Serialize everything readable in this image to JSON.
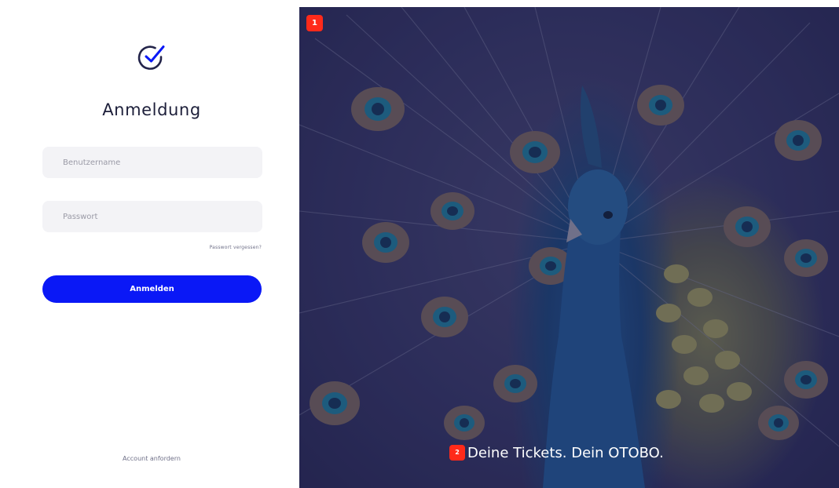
{
  "login": {
    "logo_icon": "check-circle-icon",
    "title": "Anmeldung",
    "username_placeholder": "Benutzername",
    "password_placeholder": "Passwort",
    "forgot_password": "Passwort vergessen?",
    "submit_label": "Anmelden",
    "request_account": "Account anfordern"
  },
  "hero": {
    "image": "peacock-photo",
    "marker_1": "1",
    "marker_2": "2",
    "tagline": "Deine Tickets. Dein OTOBO."
  },
  "colors": {
    "accent": "#0a18f6",
    "input_bg": "#f3f3f6",
    "marker": "#ff2a1a",
    "hero_tint": "#2e2f58"
  }
}
